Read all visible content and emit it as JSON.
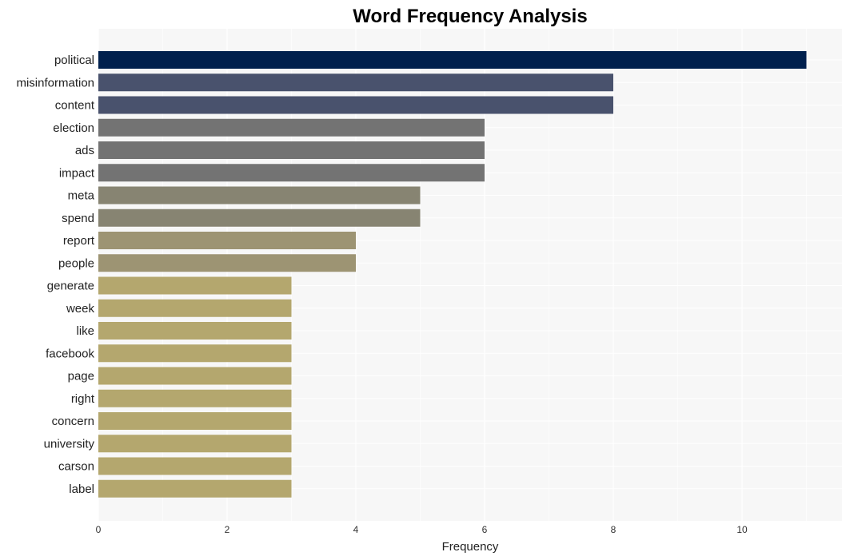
{
  "chart_data": {
    "type": "bar",
    "orientation": "horizontal",
    "title": "Word Frequency Analysis",
    "xlabel": "Frequency",
    "ylabel": "",
    "xlim": [
      0,
      11.5
    ],
    "xticks": [
      0,
      2,
      4,
      6,
      8,
      10
    ],
    "grid": true,
    "legend": "none",
    "categories": [
      "political",
      "misinformation",
      "content",
      "election",
      "ads",
      "impact",
      "meta",
      "spend",
      "report",
      "people",
      "generate",
      "week",
      "like",
      "facebook",
      "page",
      "right",
      "concern",
      "university",
      "carson",
      "label"
    ],
    "values": [
      11,
      8,
      8,
      6,
      6,
      6,
      5,
      5,
      4,
      4,
      3,
      3,
      3,
      3,
      3,
      3,
      3,
      3,
      3,
      3
    ],
    "colors": {
      "11": "#00204e",
      "8": "#49526d",
      "6": "#737373",
      "5": "#878472",
      "4": "#9d9473",
      "3": "#b4a76e"
    },
    "background": "#f7f7f7",
    "gridline_color": "#ffffff"
  }
}
